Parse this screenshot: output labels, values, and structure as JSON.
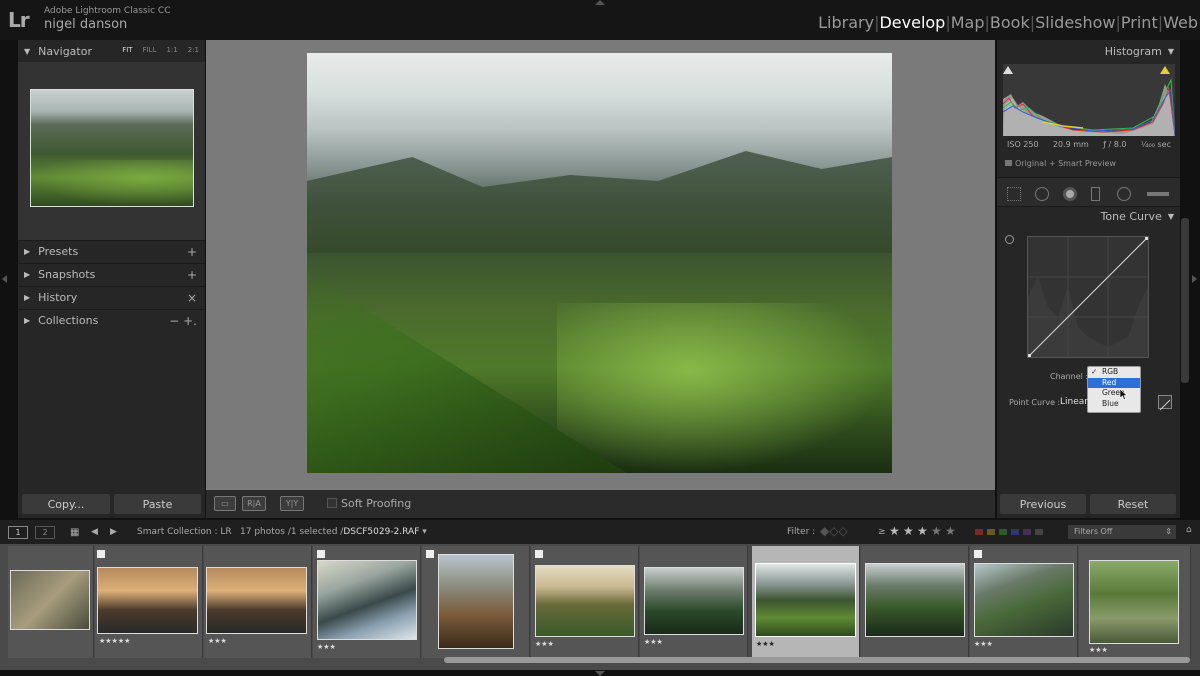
{
  "app": {
    "logo": "Lr",
    "name": "Adobe Lightroom Classic CC",
    "user": "nigel danson"
  },
  "modules": [
    "Library",
    "Develop",
    "Map",
    "Book",
    "Slideshow",
    "Print",
    "Web"
  ],
  "active_module": "Develop",
  "left_panel": {
    "navigator": {
      "title": "Navigator",
      "modes": [
        "FIT",
        "FILL",
        "1:1",
        "2:1"
      ],
      "active_mode": "FIT"
    },
    "sections": [
      {
        "label": "Presets",
        "action": "+"
      },
      {
        "label": "Snapshots",
        "action": "+"
      },
      {
        "label": "History",
        "action": "×"
      },
      {
        "label": "Collections",
        "action": "− +."
      }
    ],
    "copy_label": "Copy...",
    "paste_label": "Paste"
  },
  "toolbar": {
    "soft_proofing_label": "Soft Proofing"
  },
  "right_panel": {
    "histogram": {
      "title": "Histogram",
      "iso": "ISO 250",
      "focal": "20.9 mm",
      "aperture": "ƒ / 8.0",
      "shutter": "¹⁄₄₀₀ sec",
      "preview": "Original + Smart Preview"
    },
    "tone_curve": {
      "title": "Tone Curve",
      "channel_label": "Channel :",
      "channel_options": [
        "RGB",
        "Red",
        "Green",
        "Blue"
      ],
      "checked_option": "RGB",
      "highlighted_option": "Red",
      "point_curve_label": "Point Curve :",
      "point_curve_value": "Linear"
    },
    "previous_label": "Previous",
    "reset_label": "Reset"
  },
  "filmstrip_bar": {
    "page1": "1",
    "page2": "2",
    "source": "Smart Collection : LR",
    "count": "17 photos /1 selected /",
    "filename": "DSCF5029-2.RAF",
    "filter_label": "Filter :",
    "rating_op": "≥",
    "filters_off": "Filters Off"
  },
  "filmstrip": {
    "stars": [
      "",
      "★★★★★",
      "★★★",
      "★★★",
      "",
      "★★★",
      "★★★",
      "★★★",
      "",
      "★★★",
      "★★★"
    ]
  }
}
